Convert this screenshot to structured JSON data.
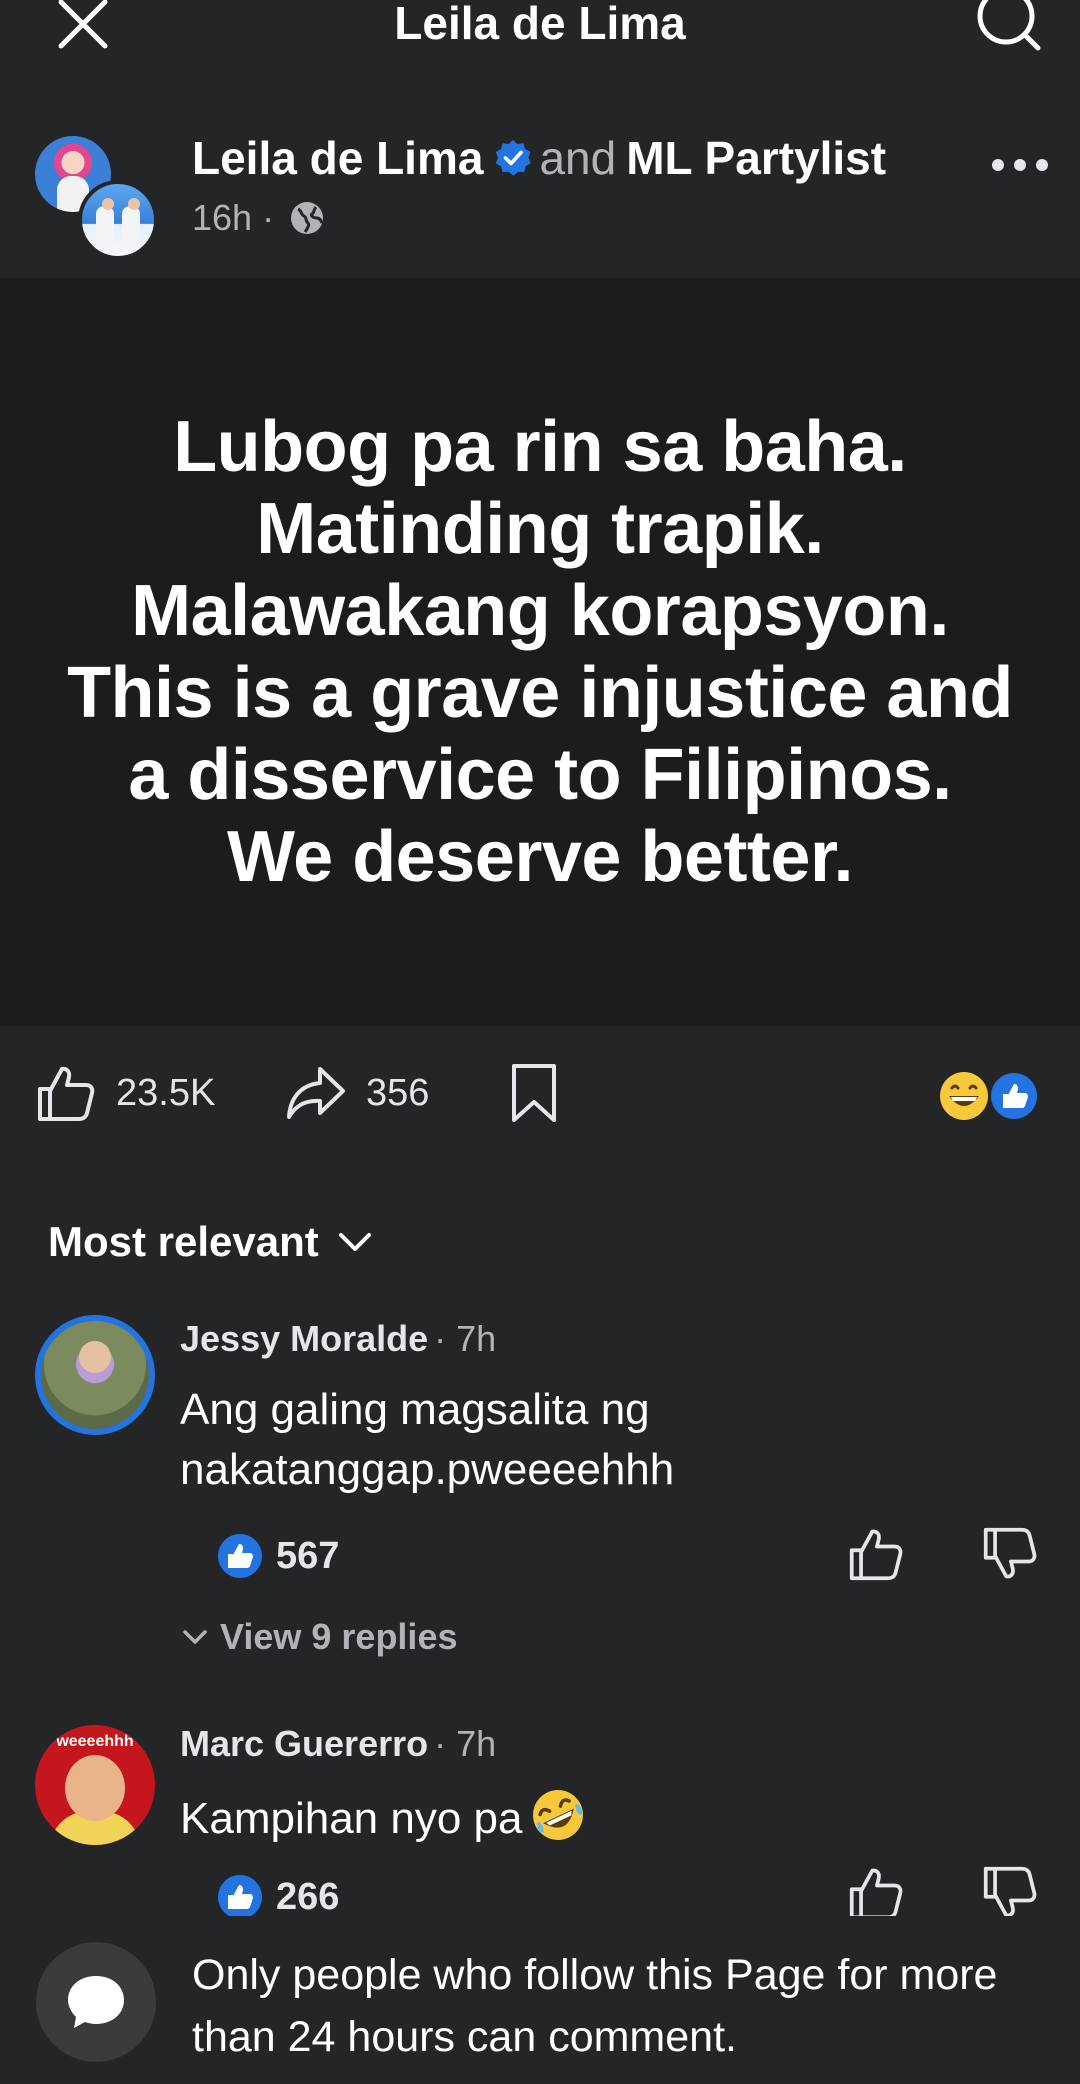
{
  "header": {
    "title": "Leila de Lima"
  },
  "post": {
    "author": "Leila de Lima",
    "conjunction": "and",
    "coauthor": "ML Partylist",
    "time": "16h",
    "separator": "·",
    "image_lines": [
      "Lubog pa rin sa baha.",
      "Matinding trapik.",
      "Malawakang korapsyon.",
      "This is a grave injustice and",
      "a disservice to Filipinos.",
      "We deserve better."
    ]
  },
  "actions": {
    "like_count": "23.5K",
    "share_count": "356",
    "reactions": [
      "grin-emoji",
      "like-emoji"
    ]
  },
  "comments_header": {
    "sort_label": "Most relevant"
  },
  "comments": [
    {
      "name": "Jessy Moralde",
      "time": "· 7h",
      "lines": [
        "Ang galing magsalita ng",
        "nakatanggap.pweeeehhh"
      ],
      "likes": "567",
      "view_replies": "View 9 replies"
    },
    {
      "name": "Marc Guererro",
      "time": "· 7h",
      "avatar_text": "weeeehhh",
      "text": "Kampihan nyo pa",
      "emoji": "rolling-laughing-emoji",
      "likes": "266"
    }
  ],
  "footer": {
    "notice": "Only people who follow this Page for more than 24 hours can comment."
  },
  "colors": {
    "background": "#242527",
    "image_background": "#1c1c1e",
    "accent_blue": "#2374e1",
    "secondary_text": "#b0b3b8"
  }
}
